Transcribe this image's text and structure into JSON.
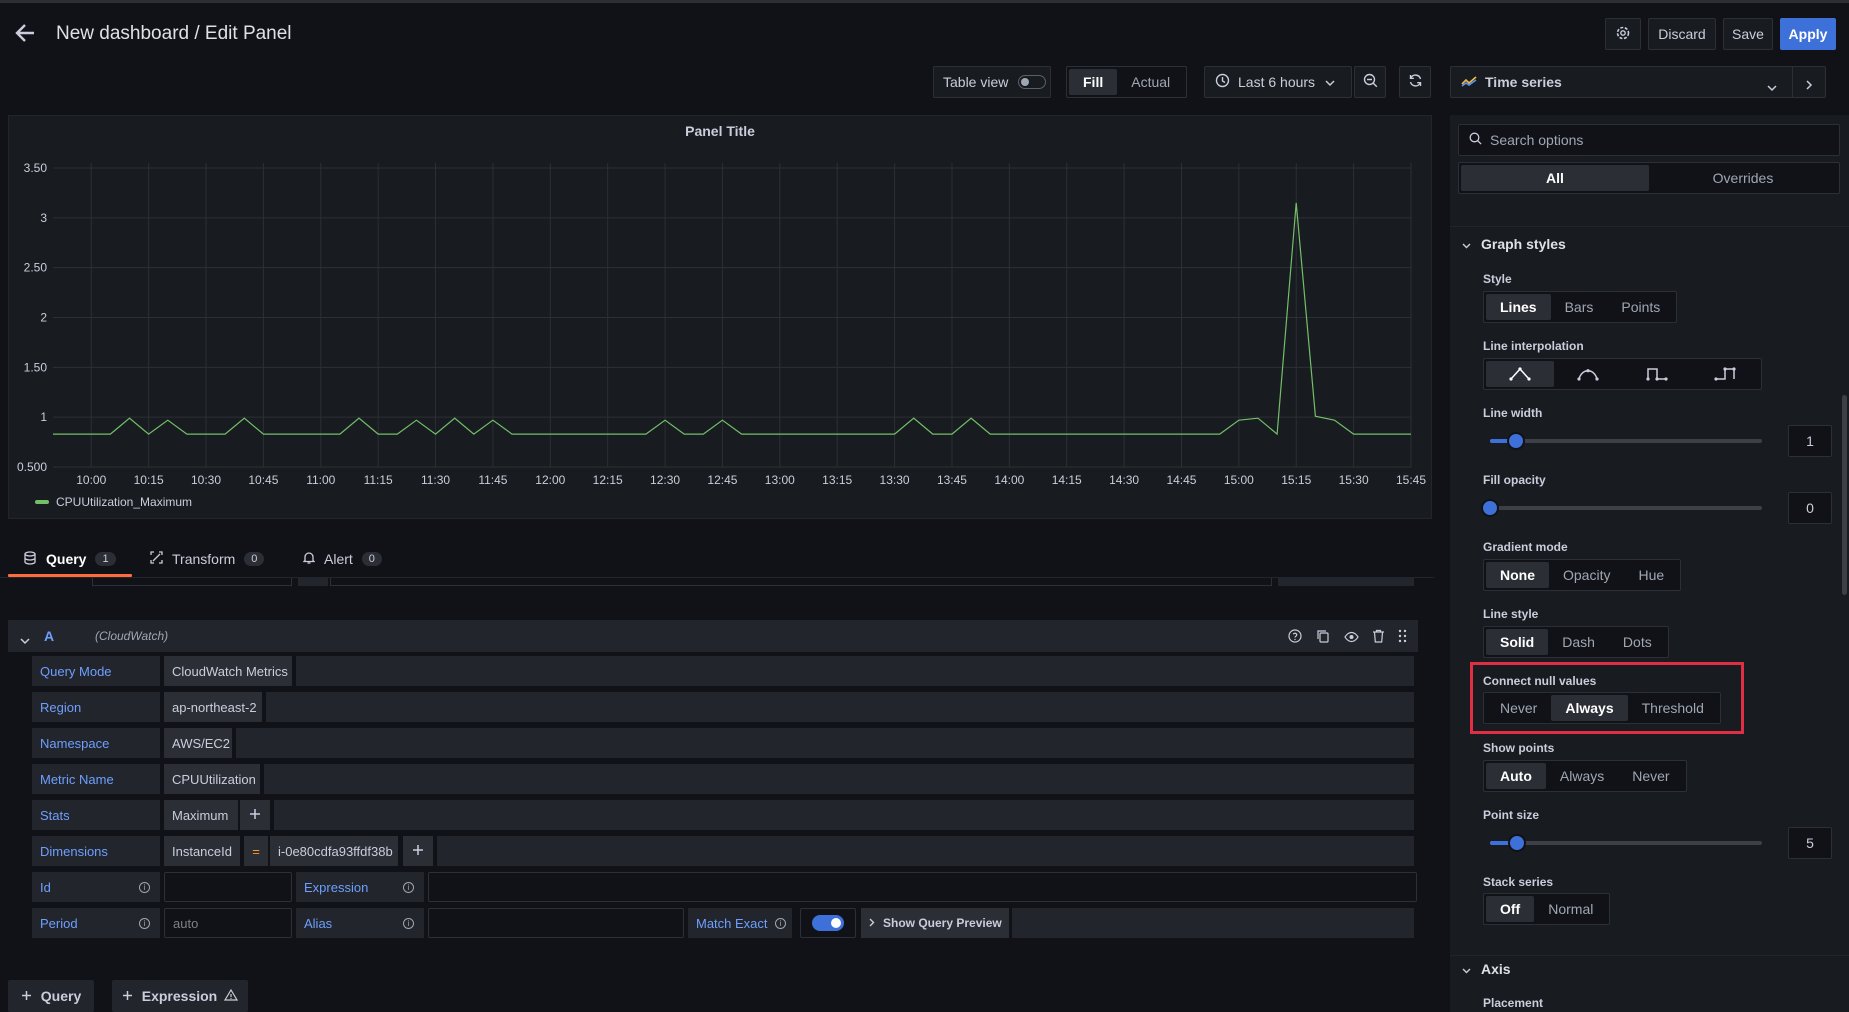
{
  "header": {
    "title": "New dashboard / Edit Panel",
    "discard": "Discard",
    "save": "Save",
    "apply": "Apply"
  },
  "toolbar": {
    "table_view": "Table view",
    "fill": "Fill",
    "actual": "Actual",
    "time_range": "Last 6 hours"
  },
  "viz_picker": {
    "label": "Time series"
  },
  "chart_data": {
    "type": "line",
    "title": "Panel Title",
    "x": [
      "09:50",
      "09:55",
      "10:00",
      "10:05",
      "10:10",
      "10:15",
      "10:20",
      "10:25",
      "10:30",
      "10:35",
      "10:40",
      "10:45",
      "10:50",
      "10:55",
      "11:00",
      "11:05",
      "11:10",
      "11:15",
      "11:20",
      "11:25",
      "11:30",
      "11:35",
      "11:40",
      "11:45",
      "11:50",
      "11:55",
      "12:00",
      "12:05",
      "12:10",
      "12:15",
      "12:20",
      "12:25",
      "12:30",
      "12:35",
      "12:40",
      "12:45",
      "12:50",
      "12:55",
      "13:00",
      "13:05",
      "13:10",
      "13:15",
      "13:20",
      "13:25",
      "13:30",
      "13:35",
      "13:40",
      "13:45",
      "13:50",
      "13:55",
      "14:00",
      "14:05",
      "14:10",
      "14:15",
      "14:20",
      "14:25",
      "14:30",
      "14:35",
      "14:40",
      "14:45",
      "14:50",
      "14:55",
      "15:00",
      "15:05",
      "15:10",
      "15:15",
      "15:20",
      "15:25",
      "15:30",
      "15:35",
      "15:40",
      "15:45"
    ],
    "series": [
      {
        "name": "CPUUtilization_Maximum",
        "color": "#73bf69",
        "values": [
          0.83,
          0.83,
          0.83,
          0.83,
          0.99,
          0.83,
          0.97,
          0.83,
          0.83,
          0.83,
          0.99,
          0.83,
          0.83,
          0.83,
          0.83,
          0.83,
          0.99,
          0.83,
          0.83,
          0.97,
          0.83,
          0.99,
          0.83,
          0.97,
          0.83,
          0.83,
          0.83,
          0.83,
          0.83,
          0.83,
          0.83,
          0.83,
          0.97,
          0.83,
          0.83,
          0.97,
          0.83,
          0.83,
          0.83,
          0.83,
          0.83,
          0.83,
          0.83,
          0.83,
          0.83,
          0.99,
          0.83,
          0.83,
          0.99,
          0.83,
          0.83,
          0.83,
          0.83,
          0.83,
          0.83,
          0.83,
          0.83,
          0.83,
          0.83,
          0.83,
          0.83,
          0.83,
          0.97,
          0.99,
          0.83,
          3.15,
          1.01,
          0.97,
          0.83,
          0.83,
          0.83,
          0.83
        ]
      }
    ],
    "y_ticks": [
      "3.50",
      "3",
      "2.50",
      "2",
      "1.50",
      "1",
      "0.500"
    ],
    "x_ticks": [
      "10:00",
      "10:15",
      "10:30",
      "10:45",
      "11:00",
      "11:15",
      "11:30",
      "11:45",
      "12:00",
      "12:15",
      "12:30",
      "12:45",
      "13:00",
      "13:15",
      "13:30",
      "13:45",
      "14:00",
      "14:15",
      "14:30",
      "14:45",
      "15:00",
      "15:15",
      "15:30",
      "15:45"
    ],
    "ylim": [
      0.5,
      3.55
    ],
    "grid": true,
    "legend": "bottom-left"
  },
  "tabs": [
    {
      "label": "Query",
      "count": "1"
    },
    {
      "label": "Transform",
      "count": "0"
    },
    {
      "label": "Alert",
      "count": "0"
    }
  ],
  "query": {
    "ref": "A",
    "datasource": "(CloudWatch)",
    "query_mode_label": "Query Mode",
    "query_mode": "CloudWatch Metrics",
    "region_label": "Region",
    "region": "ap-northeast-2",
    "namespace_label": "Namespace",
    "namespace": "AWS/EC2",
    "metric_label": "Metric Name",
    "metric": "CPUUtilization",
    "stats_label": "Stats",
    "stats": "Maximum",
    "dimensions_label": "Dimensions",
    "dim_key": "InstanceId",
    "dim_op": "=",
    "dim_value": "i-0e80cdfa93ffdf38b",
    "id_label": "Id",
    "expression_label": "Expression",
    "period_label": "Period",
    "period_placeholder": "auto",
    "alias_label": "Alias",
    "match_exact_label": "Match Exact",
    "show_preview": "Show Query Preview"
  },
  "bottom_buttons": {
    "query": "Query",
    "expression": "Expression"
  },
  "options": {
    "search_placeholder": "Search options",
    "tab_all": "All",
    "tab_overrides": "Overrides",
    "graph_styles": "Graph styles",
    "style_label": "Style",
    "style": [
      "Lines",
      "Bars",
      "Points"
    ],
    "line_interp_label": "Line interpolation",
    "line_width_label": "Line width",
    "line_width_value": "1",
    "fill_opacity_label": "Fill opacity",
    "fill_opacity_value": "0",
    "gradient_label": "Gradient mode",
    "gradient": [
      "None",
      "Opacity",
      "Hue"
    ],
    "line_style_label": "Line style",
    "line_style": [
      "Solid",
      "Dash",
      "Dots"
    ],
    "connect_null_label": "Connect null values",
    "connect_null": [
      "Never",
      "Always",
      "Threshold"
    ],
    "show_points_label": "Show points",
    "show_points": [
      "Auto",
      "Always",
      "Never"
    ],
    "point_size_label": "Point size",
    "point_size_value": "5",
    "stack_label": "Stack series",
    "stack": [
      "Off",
      "Normal"
    ],
    "axis": "Axis",
    "placement_label": "Placement"
  }
}
